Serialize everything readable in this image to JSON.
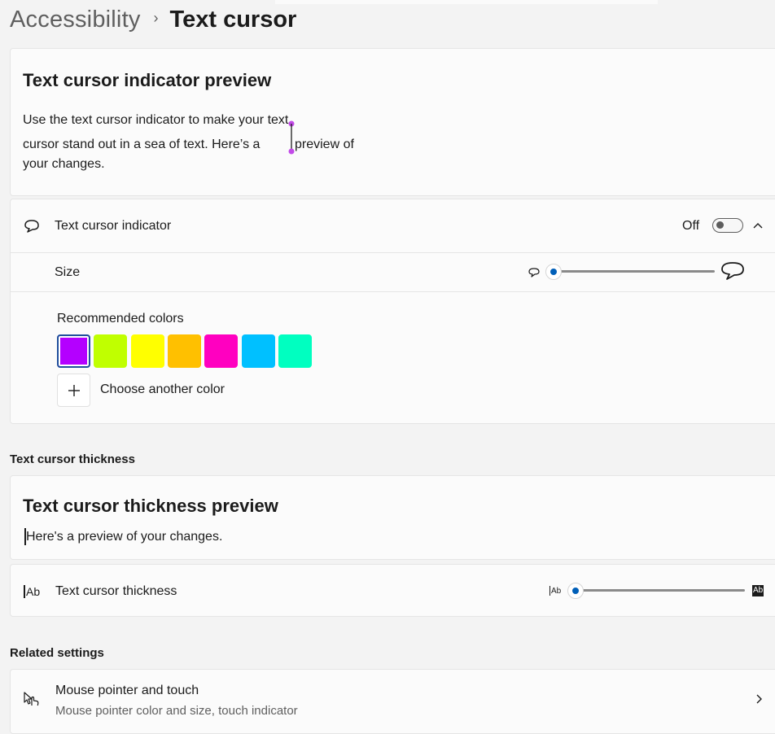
{
  "breadcrumb": {
    "parent": "Accessibility",
    "separator": "›",
    "current": "Text cursor"
  },
  "indicator_preview": {
    "title": "Text cursor indicator preview",
    "line1": "Use the text cursor indicator to make your text",
    "line2a": "cursor stand out in a sea of text. Here’s a",
    "line2b": "preview of",
    "line3": "your changes."
  },
  "indicator_row": {
    "icon": "cursor-indicator-icon",
    "label": "Text cursor indicator",
    "toggle_state": "Off",
    "expanded": true
  },
  "size_row": {
    "label": "Size",
    "slider_value_fraction": 0.0
  },
  "colors": {
    "label": "Recommended colors",
    "swatches": [
      "#b400ff",
      "#c0ff00",
      "#ffff00",
      "#ffc000",
      "#ff00c0",
      "#00c0ff",
      "#00ffc0"
    ],
    "selected_index": 0,
    "add_label": "Choose another color",
    "accent": "#005fb8"
  },
  "thickness_section": {
    "header": "Text cursor thickness",
    "preview_title": "Text cursor thickness preview",
    "preview_text": "Here's a preview of your changes.",
    "row_label": "Text cursor thickness",
    "icon_text": "Ab",
    "slider_value_fraction": 0.0
  },
  "related": {
    "header": "Related settings",
    "item_title": "Mouse pointer and touch",
    "item_subtitle": "Mouse pointer color and size, touch indicator",
    "icon": "mouse-pointer-touch-icon"
  }
}
